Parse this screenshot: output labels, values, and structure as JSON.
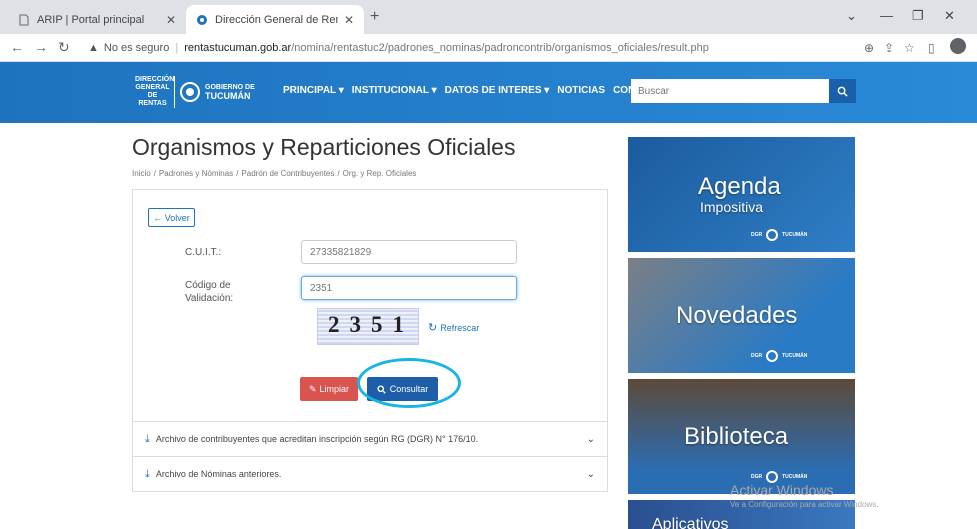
{
  "browser": {
    "tabs": [
      {
        "title": "ARIP | Portal principal"
      },
      {
        "title": "Dirección General de Rentas | O..."
      }
    ],
    "new_tab": "+",
    "address": {
      "security": "No es seguro",
      "host": "rentastucuman.gob.ar",
      "path": "/nomina/rentastuc2/padrones_nominas/padroncontrib/organismos_oficiales/result.php"
    }
  },
  "site": {
    "logo": {
      "dgr": "DIRECCIÓN GENERAL DE RENTAS",
      "gob_top": "GOBIERNO DE",
      "gob_name": "TUCUMÁN"
    },
    "nav": [
      "PRINCIPAL ▾",
      "INSTITUCIONAL ▾",
      "DATOS DE INTERES ▾",
      "NOTICIAS",
      "CONTACTO"
    ],
    "search_placeholder": "Buscar"
  },
  "page": {
    "title": "Organismos y Reparticiones Oficiales",
    "breadcrumb": [
      "Inicio",
      "Padrones y Nóminas",
      "Padrón de Contribuyentes",
      "Org. y Rep. Oficiales"
    ]
  },
  "form": {
    "back_label": "← Volver",
    "cuit_label": "C.U.I.T.:",
    "cuit_value": "27335821829",
    "code_label_1": "Código de",
    "code_label_2": "Validación:",
    "code_value": "2351",
    "captcha_text": "2351",
    "refresh_label": "Refrescar",
    "clear_label": "Limpiar",
    "submit_label": "Consultar"
  },
  "accordion": [
    {
      "label": "Archivo de contribuyentes que acreditan inscripción según RG (DGR) N° 176/10."
    },
    {
      "label": "Archivo de Nóminas anteriores."
    }
  ],
  "banners": [
    {
      "title": "Agenda",
      "subtitle": "Impositiva"
    },
    {
      "title": "Novedades"
    },
    {
      "title": "Biblioteca"
    },
    {
      "title": "Aplicativos"
    }
  ],
  "watermark": {
    "line1": "Activar Windows",
    "line2": "Ve a Configuración para activar Windows."
  }
}
